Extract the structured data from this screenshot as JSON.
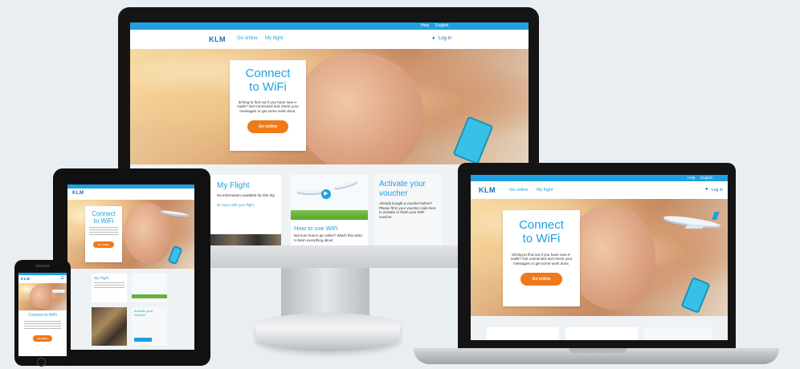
{
  "colors": {
    "klm_blue": "#1fa0e0",
    "cta_orange": "#f07a1a",
    "background": "#e9eef3"
  },
  "desktop": {
    "topbar": {
      "help": "Help",
      "language": "English"
    },
    "nav": {
      "logo": "KLM",
      "link1": "Go online",
      "link2": "My flight",
      "login": "Log in"
    },
    "hero_card": {
      "title_line1": "Connect",
      "title_line2": "to WiFi",
      "body": "Itching to find out if you have new e-mails? Get connected and check your messages or get some work done.",
      "button": "Go online"
    },
    "tiles": {
      "myflight_title": "My Flight",
      "myflight_body": "No information available for this trip",
      "myflight_link": "Or log in with your flight",
      "howto_title": "How to use WiFi",
      "howto_body": "Not sure how to go online? Watch this video to learn everything about",
      "voucher_title": "Activate your voucher",
      "voucher_body": "Already bought a voucher before? Please fill in your voucher code here to activate or finish your WiFi voucher."
    }
  },
  "laptop": {
    "topbar": {
      "help": "Help",
      "language": "English"
    },
    "nav": {
      "logo": "KLM",
      "link1": "Go online",
      "link2": "My flight",
      "login": "Log in"
    },
    "hero_card": {
      "title_line1": "Connect",
      "title_line2": "to WiFi",
      "body": "Itching to find out if you have new e-mails? Get connected and check your messages or get some work done.",
      "button": "Go online"
    }
  },
  "tablet": {
    "nav": {
      "logo": "KLM"
    },
    "hero_card": {
      "title_line1": "Connect",
      "title_line2": "to WiFi",
      "button": "Go online"
    },
    "tiles": {
      "myflight_title": "My Flight",
      "voucher_title": "Activate your voucher"
    }
  },
  "phone": {
    "nav": {
      "logo": "KLM"
    },
    "hero_card": {
      "title": "Connect to WiFi",
      "button": "Go online"
    }
  }
}
